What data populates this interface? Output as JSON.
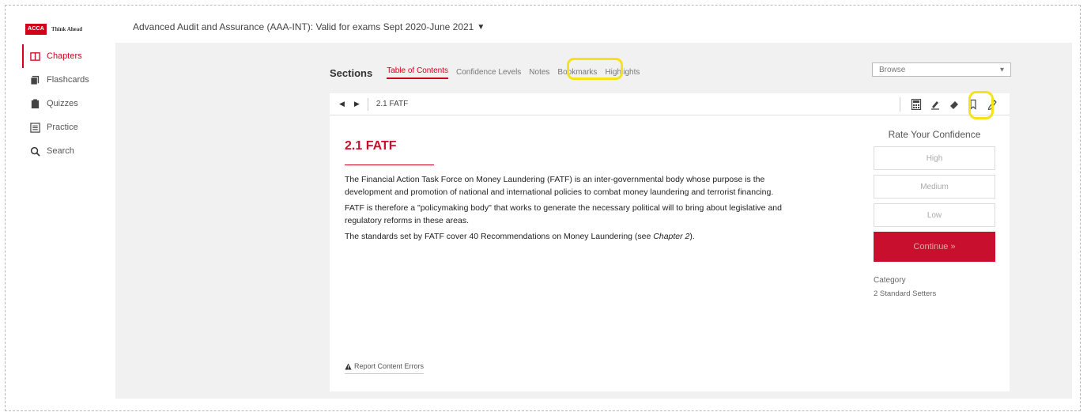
{
  "logo": {
    "brand": "ACCA",
    "tagline": "Think Ahead"
  },
  "course": {
    "title": "Advanced Audit and Assurance (AAA-INT): Valid for exams Sept 2020-June 2021",
    "caret": "▼"
  },
  "sidebar": {
    "items": [
      {
        "label": "Chapters",
        "icon": "book-icon",
        "active": true
      },
      {
        "label": "Flashcards",
        "icon": "cards-icon",
        "active": false
      },
      {
        "label": "Quizzes",
        "icon": "clipboard-icon",
        "active": false
      },
      {
        "label": "Practice",
        "icon": "list-icon",
        "active": false
      },
      {
        "label": "Search",
        "icon": "search-icon",
        "active": false
      }
    ]
  },
  "sections": {
    "label": "Sections",
    "tabs": [
      {
        "label": "Table of Contents",
        "active": true
      },
      {
        "label": "Confidence Levels"
      },
      {
        "label": "Notes"
      },
      {
        "label": "Bookmarks",
        "highlighted": true
      },
      {
        "label": "Highlights"
      }
    ],
    "browse": {
      "label": "Browse",
      "caret": "▾"
    }
  },
  "toolbar": {
    "prev": "◀",
    "next": "▶",
    "crumb": "2.1 FATF",
    "tools": [
      "calculator-icon",
      "highlighter-icon",
      "eraser-icon",
      "bookmark-icon",
      "pencil-icon"
    ]
  },
  "content": {
    "heading": "2.1 FATF",
    "para1": "The Financial Action Task Force on Money Laundering (FATF) is an inter-governmental body whose purpose is the development and promotion of national and international policies to combat money laundering and terrorist financing.",
    "para2": "FATF is therefore a \"policymaking body\" that works to generate the necessary political will to bring about legislative and regulatory reforms in these areas.",
    "para3_pre": "The standards set by FATF cover 40 Recommendations on Money Laundering (see ",
    "para3_ital": "Chapter 2",
    "para3_post": ").",
    "report": "Report Content Errors"
  },
  "confidence": {
    "title": "Rate Your Confidence",
    "high": "High",
    "medium": "Medium",
    "low": "Low",
    "continue": "Continue »",
    "category_label": "Category",
    "category_value": "2 Standard Setters"
  },
  "colors": {
    "accent": "#d0021b",
    "highlight_ring": "#f5e21a"
  }
}
